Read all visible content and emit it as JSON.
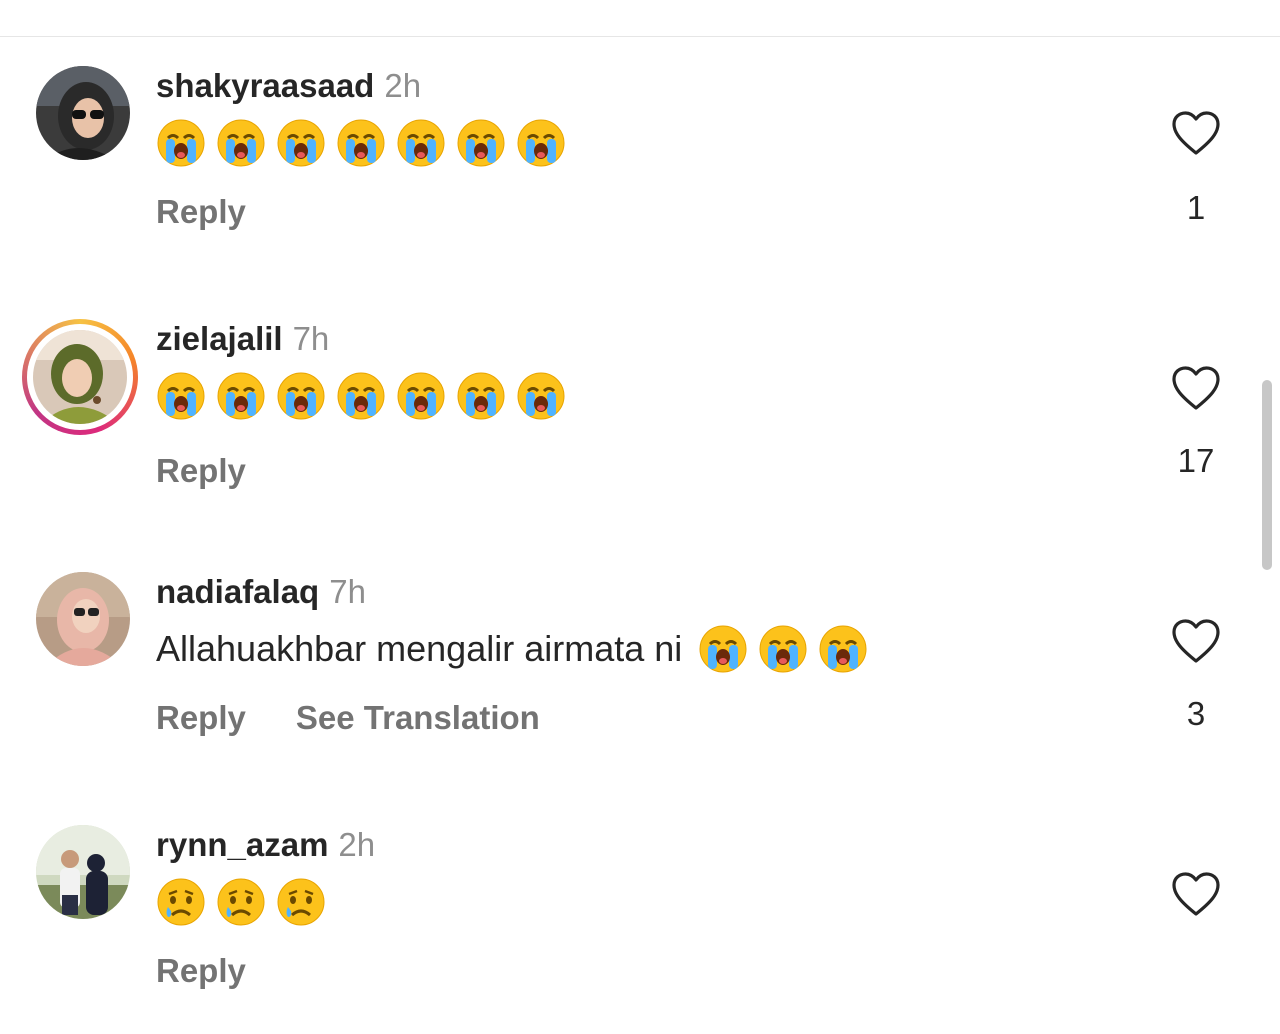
{
  "comments": [
    {
      "username": "shakyraasaad",
      "time": "2h",
      "text": "",
      "emojis": [
        "loudly-crying-face",
        "loudly-crying-face",
        "loudly-crying-face",
        "loudly-crying-face",
        "loudly-crying-face",
        "loudly-crying-face",
        "loudly-crying-face"
      ],
      "reply_label": "Reply",
      "likes": "1",
      "avatar_icon": "user-avatar-shakyraasaad",
      "has_story_ring": false
    },
    {
      "username": "zielajalil",
      "time": "7h",
      "text": "",
      "emojis": [
        "loudly-crying-face",
        "loudly-crying-face",
        "loudly-crying-face",
        "loudly-crying-face",
        "loudly-crying-face",
        "loudly-crying-face",
        "loudly-crying-face"
      ],
      "reply_label": "Reply",
      "likes": "17",
      "avatar_icon": "user-avatar-zielajalil",
      "has_story_ring": true
    },
    {
      "username": "nadiafalaq",
      "time": "7h",
      "text": "Allahuakhbar mengalir airmata ni",
      "emojis": [
        "loudly-crying-face",
        "loudly-crying-face",
        "loudly-crying-face"
      ],
      "reply_label": "Reply",
      "translation_label": "See Translation",
      "likes": "3",
      "avatar_icon": "user-avatar-nadiafalaq",
      "has_story_ring": false
    },
    {
      "username": "rynn_azam",
      "time": "2h",
      "text": "",
      "emojis": [
        "crying-face",
        "crying-face",
        "crying-face"
      ],
      "reply_label": "Reply",
      "likes": "",
      "avatar_icon": "user-avatar-rynn-azam",
      "has_story_ring": false
    }
  ],
  "icons": {
    "like": "heart-outline-icon"
  },
  "colors": {
    "text": "#262626",
    "secondary_text": "#8e8e8e",
    "action_text": "#737373",
    "story_ring_start": "#f58529",
    "story_ring_end": "#dd2a7b"
  }
}
